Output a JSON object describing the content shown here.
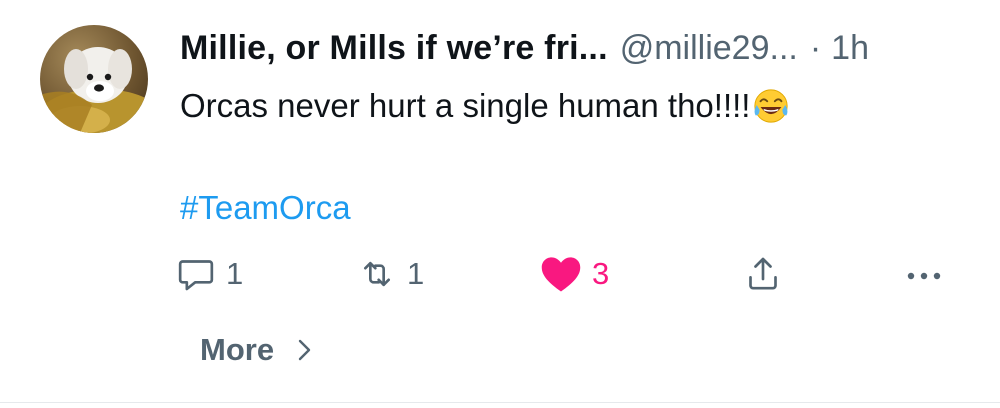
{
  "tweet": {
    "author": {
      "display_name": "Millie, or Mills if we’re fri...",
      "handle": "@millie29...",
      "separator": "·",
      "time": "1h",
      "avatar_icon": "dog-avatar"
    },
    "text": "Orcas never hurt a single human tho!!!!",
    "emoji": "face-with-tears-of-joy",
    "hashtag": "#TeamOrca"
  },
  "actions": {
    "reply": {
      "icon": "reply-icon",
      "count": "1"
    },
    "retweet": {
      "icon": "retweet-icon",
      "count": "1"
    },
    "like": {
      "icon": "heart-icon",
      "count": "3",
      "liked": true
    },
    "share": {
      "icon": "share-icon"
    },
    "more": {
      "icon": "more-options-icon"
    }
  },
  "more_link": {
    "label": "More"
  },
  "colors": {
    "text_primary": "#0f1419",
    "text_secondary": "#536471",
    "link": "#1d9bf0",
    "like": "#f91880"
  }
}
